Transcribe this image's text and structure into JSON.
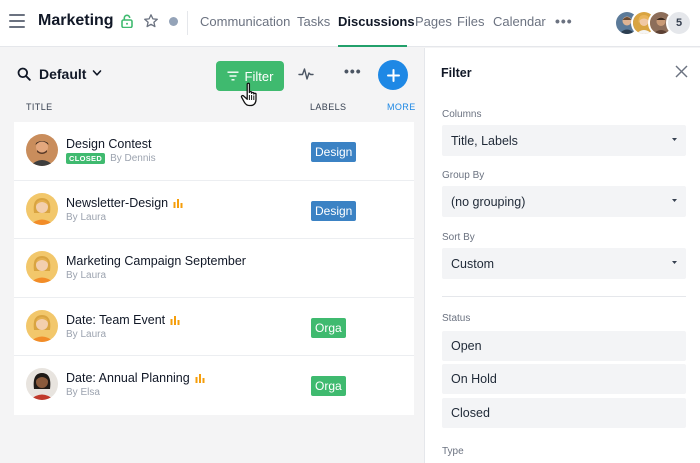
{
  "header": {
    "workspace_title": "Marketing",
    "tabs": [
      {
        "label": "Communication"
      },
      {
        "label": "Tasks"
      },
      {
        "label": "Discussions"
      },
      {
        "label": "Pages"
      },
      {
        "label": "Files"
      },
      {
        "label": "Calendar"
      }
    ],
    "active_tab": "Discussions",
    "members_extra_count": "5"
  },
  "toolbar": {
    "view_label": "Default",
    "filter_label": "Filter"
  },
  "columns": {
    "title": "TITLE",
    "labels": "LABELS",
    "more": "MORE"
  },
  "discussions": [
    {
      "title": "Design Contest",
      "status_badge": "CLOSED",
      "author": "By Dennis",
      "label": "Design",
      "label_color": "#3b82c4",
      "activity_icon": false,
      "avatar": "man-dark"
    },
    {
      "title": "Newsletter-Design",
      "status_badge": "",
      "author": "By Laura",
      "label": "Design",
      "label_color": "#3b82c4",
      "activity_icon": true,
      "avatar": "woman-blonde"
    },
    {
      "title": "Marketing Campaign September",
      "status_badge": "",
      "author": "By Laura",
      "label": "",
      "label_color": "",
      "activity_icon": false,
      "avatar": "woman-blonde"
    },
    {
      "title": "Date: Team Event",
      "status_badge": "",
      "author": "By Laura",
      "label": "Orga",
      "label_color": "#3fba6f",
      "activity_icon": true,
      "avatar": "woman-blonde"
    },
    {
      "title": "Date: Annual Planning",
      "status_badge": "",
      "author": "By Elsa",
      "label": "Orga",
      "label_color": "#3fba6f",
      "activity_icon": true,
      "avatar": "woman-dark"
    }
  ],
  "filter_panel": {
    "title": "Filter",
    "columns_label": "Columns",
    "columns_value": "Title, Labels",
    "group_by_label": "Group By",
    "group_by_value": "(no grouping)",
    "sort_by_label": "Sort By",
    "sort_by_value": "Custom",
    "status_label": "Status",
    "status_options": [
      "Open",
      "On Hold",
      "Closed"
    ],
    "type_label": "Type"
  },
  "colors": {
    "accent_green": "#3fba6f",
    "accent_blue": "#1e88e5",
    "activity_orange": "#f59e0b"
  }
}
